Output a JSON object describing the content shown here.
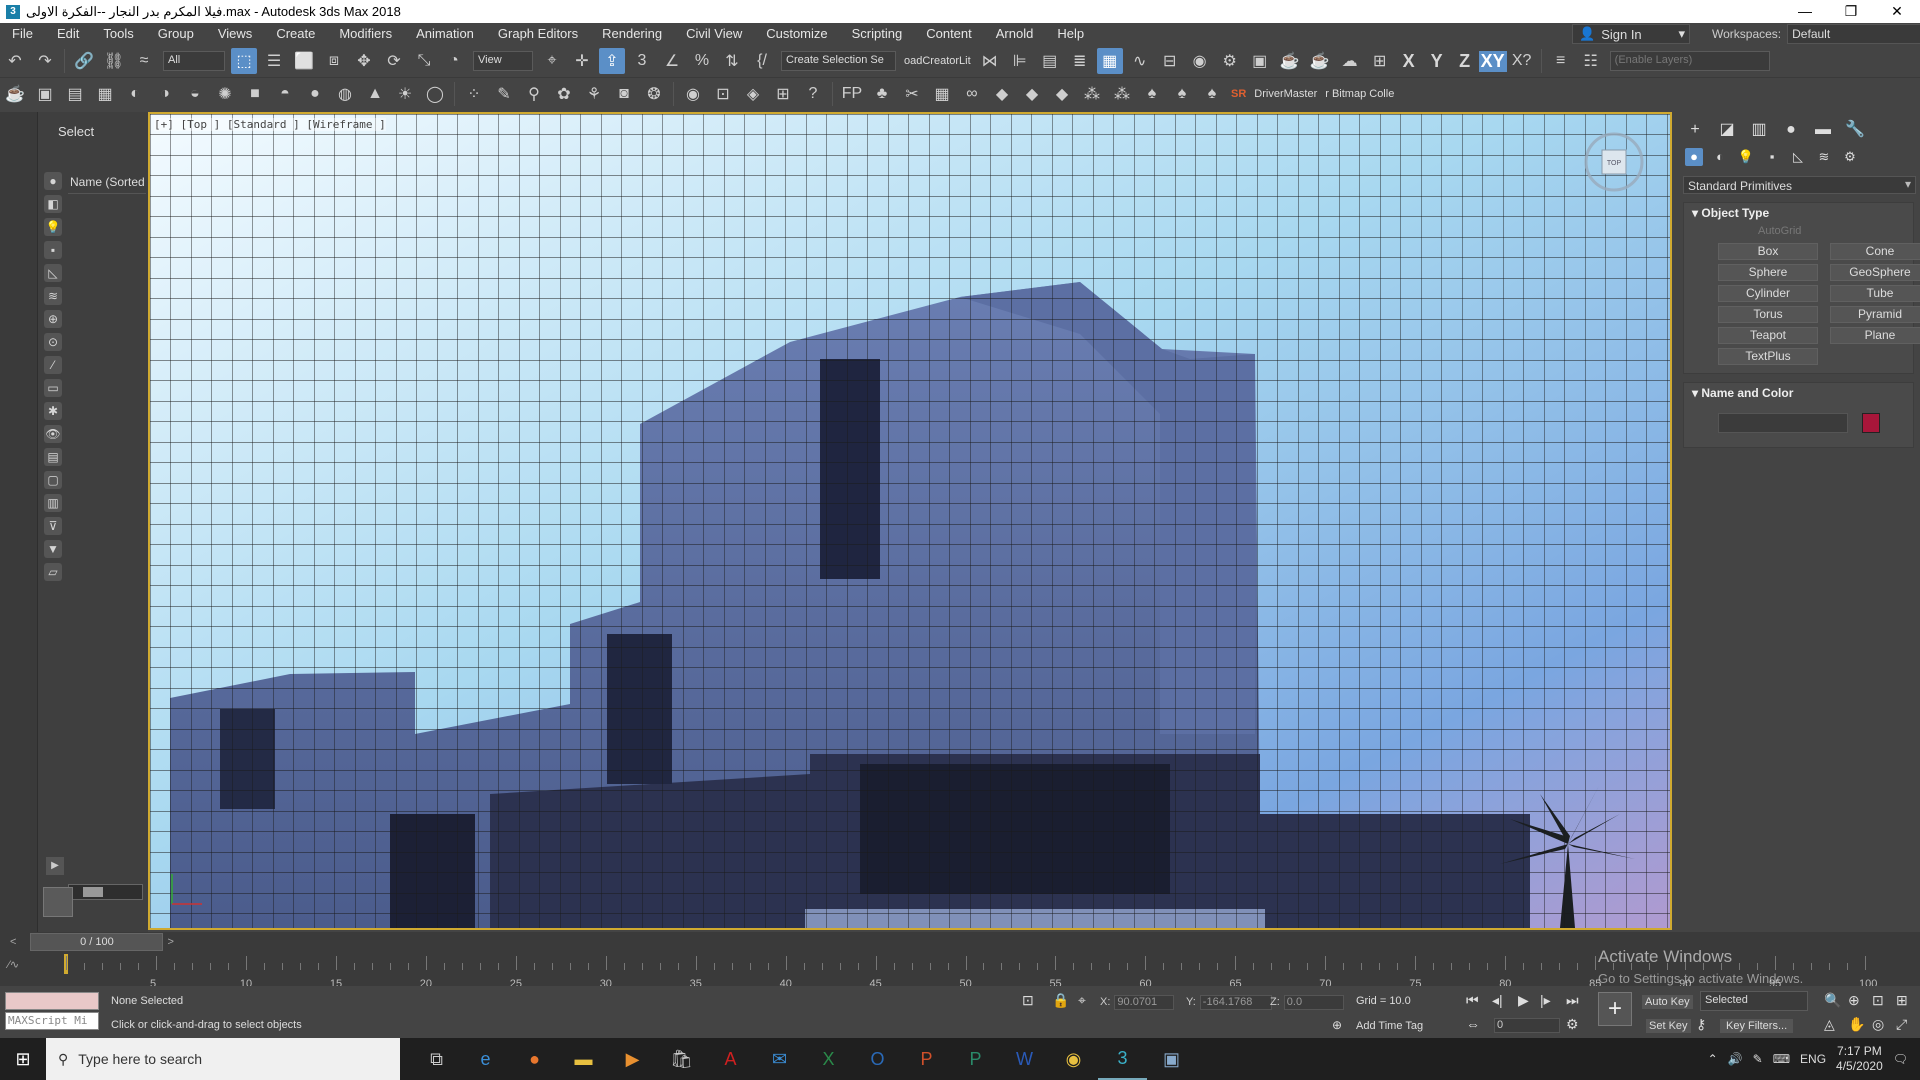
{
  "window": {
    "title": "فيلا المكرم بدر النجار --الفكرة الاولى.max - Autodesk 3ds Max 2018",
    "minimize": "—",
    "restore": "❐",
    "close": "✕"
  },
  "menu": [
    "File",
    "Edit",
    "Tools",
    "Group",
    "Views",
    "Create",
    "Modifiers",
    "Animation",
    "Graph Editors",
    "Rendering",
    "Civil View",
    "Customize",
    "Scripting",
    "Content",
    "Arnold",
    "Help"
  ],
  "signin": {
    "label": "Sign In"
  },
  "workspace": {
    "label": "Workspaces:",
    "value": "Default"
  },
  "toolbar": {
    "filter": "All",
    "refcoord": "View",
    "selset": "Create Selection Se",
    "loadcreator": "oadCreatorLit",
    "axis_x": "X",
    "axis_y": "Y",
    "axis_z": "Z",
    "axis_xy": "XY",
    "layers_placeholder": "(Enable Layers)",
    "drivermaster": "DriverMaster",
    "bitmap": "r Bitmap Colle",
    "sr": "SR"
  },
  "scene": {
    "header": "Select",
    "column": "Name (Sorted A"
  },
  "viewport": {
    "label": "[+] [Top ] [Standard ] [Wireframe ]",
    "cube_label": "TOP"
  },
  "command": {
    "category": "Standard Primitives",
    "object_type": "Object Type",
    "autogrid": "AutoGrid",
    "primitives": [
      "Box",
      "Cone",
      "Sphere",
      "GeoSphere",
      "Cylinder",
      "Tube",
      "Torus",
      "Pyramid",
      "Teapot",
      "Plane",
      "TextPlus"
    ],
    "name_color": "Name and Color",
    "object_color": "#a8163a"
  },
  "time": {
    "slider": "0 / 100",
    "ticks": [
      "5",
      "10",
      "15",
      "20",
      "25",
      "30",
      "35",
      "40",
      "45",
      "50",
      "55",
      "60",
      "65",
      "70",
      "75",
      "80",
      "85",
      "90",
      "95",
      "100"
    ]
  },
  "status": {
    "selection": "None Selected",
    "prompt": "Click or click-and-drag to select objects",
    "maxscript": "MAXScript Mi",
    "x_label": "X:",
    "x": "90.0701",
    "y_label": "Y:",
    "y": "-164.1768",
    "z_label": "Z:",
    "z": "0.0",
    "grid": "Grid = 10.0",
    "add_time_tag": "Add Time Tag",
    "autokey": "Auto Key",
    "setkey": "Set Key",
    "selected": "Selected",
    "keyfilters": "Key Filters...",
    "frame": "0"
  },
  "watermark": {
    "line1": "Activate Windows",
    "line2": "Go to Settings to activate Windows."
  },
  "taskbar": {
    "search": "Type here to search",
    "lang": "ENG",
    "time": "7:17 PM",
    "date": "4/5/2020"
  }
}
